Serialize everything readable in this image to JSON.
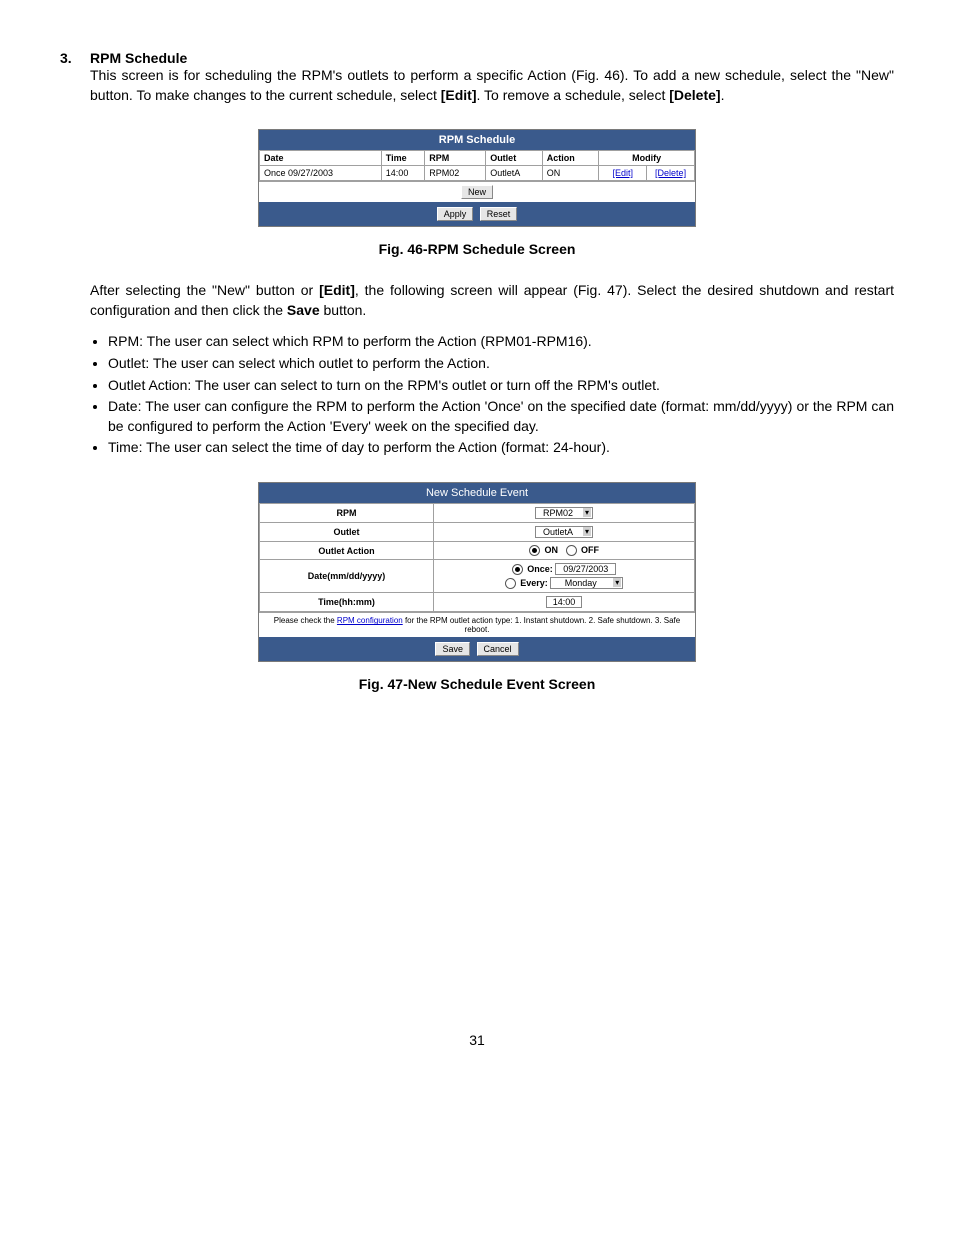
{
  "heading": {
    "num": "3.",
    "title": "RPM Schedule"
  },
  "para1_a": "This screen is for scheduling the RPM's outlets to perform a specific Action (Fig. 46).  To add a new schedule, select the \"New\" button.  To make changes to the current schedule, select ",
  "para1_b": "[Edit]",
  "para1_c": ".  To remove a schedule, select ",
  "para1_d": "[Delete]",
  "para1_e": ".",
  "fig46": {
    "title": "RPM Schedule",
    "headers": {
      "date": "Date",
      "time": "Time",
      "rpm": "RPM",
      "outlet": "Outlet",
      "action": "Action",
      "modify": "Modify"
    },
    "row": {
      "date": "Once 09/27/2003",
      "time": "14:00",
      "rpm": "RPM02",
      "outlet": "OutletA",
      "action": "ON",
      "edit": "[Edit]",
      "delete": "[Delete]"
    },
    "new_btn": "New",
    "apply_btn": "Apply",
    "reset_btn": "Reset",
    "caption": "Fig. 46-RPM Schedule Screen"
  },
  "para2_a": "After selecting the \"New\" button or ",
  "para2_b": "[Edit]",
  "para2_c": ", the following screen will appear (Fig. 47).  Select the desired shutdown and restart configuration and then click the ",
  "para2_d": "Save",
  "para2_e": " button.",
  "bullets": [
    "RPM:  The user can select which RPM to perform the Action (RPM01-RPM16).",
    "Outlet:  The user can select which outlet to perform the Action.",
    "Outlet Action:  The user can select to turn on the RPM's outlet or turn off the RPM's outlet.",
    "Date:  The user can configure the RPM to perform the Action 'Once' on the specified date (format:  mm/dd/yyyy) or the RPM can be configured to perform the Action 'Every' week on the specified day.",
    "Time:  The user can select the time of day to perform the Action (format:  24-hour)."
  ],
  "fig47": {
    "title": "New Schedule Event",
    "labels": {
      "rpm": "RPM",
      "outlet": "Outlet",
      "outlet_action": "Outlet Action",
      "date": "Date(mm/dd/yyyy)",
      "time": "Time(hh:mm)"
    },
    "vals": {
      "rpm": "RPM02",
      "outlet": "OutletA",
      "on": "ON",
      "off": "OFF",
      "once_label": "Once:",
      "once_val": "09/27/2003",
      "every_label": "Every:",
      "every_val": "Monday",
      "time": "14:00"
    },
    "note_a": "Please check the ",
    "note_link": "RPM configuration",
    "note_b": " for the RPM outlet action type: 1. Instant shutdown. 2. Safe shutdown. 3. Safe reboot.",
    "save_btn": "Save",
    "cancel_btn": "Cancel",
    "caption": "Fig. 47-New Schedule Event Screen"
  },
  "page_number": "31"
}
